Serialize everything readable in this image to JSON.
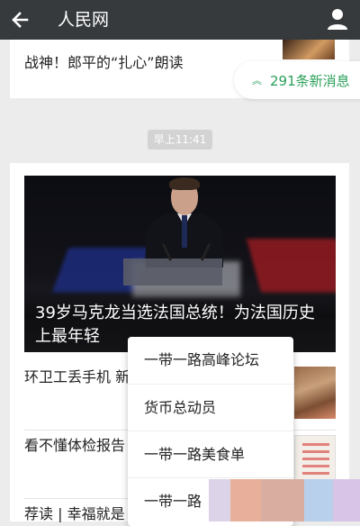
{
  "header": {
    "title": "人民网",
    "back_icon": "arrow-left-icon",
    "profile_icon": "person-icon",
    "bg_color": "#363a3d"
  },
  "feed": {
    "top_card": {
      "headline": "战神！郎平的“扎心”朗读"
    },
    "new_messages": {
      "label": "291条新消息",
      "icon": "double-chevron-up-icon",
      "color": "#2ba05a"
    },
    "timestamp": "早上11:41",
    "main_card": {
      "hero_caption": "39岁马克龙当选法国总统！为法国历史上最年轻",
      "items": [
        {
          "title": "环卫工丢手机 新手机 谎称\"活"
        },
        {
          "title": "看不懂体检报告 几种“中招率”"
        },
        {
          "title": "荐读 | 幸福就是"
        }
      ]
    }
  },
  "popup_menu": {
    "items": [
      {
        "label": "一带一路高峰论坛"
      },
      {
        "label": "货币总动员"
      },
      {
        "label": "一带一路美食单"
      },
      {
        "label": "一带一路"
      }
    ]
  },
  "overlay_colors": [
    "#ddd3e8",
    "#e8b09a",
    "#d9aea0",
    "#b9d0ec",
    "#d8c4e6"
  ]
}
